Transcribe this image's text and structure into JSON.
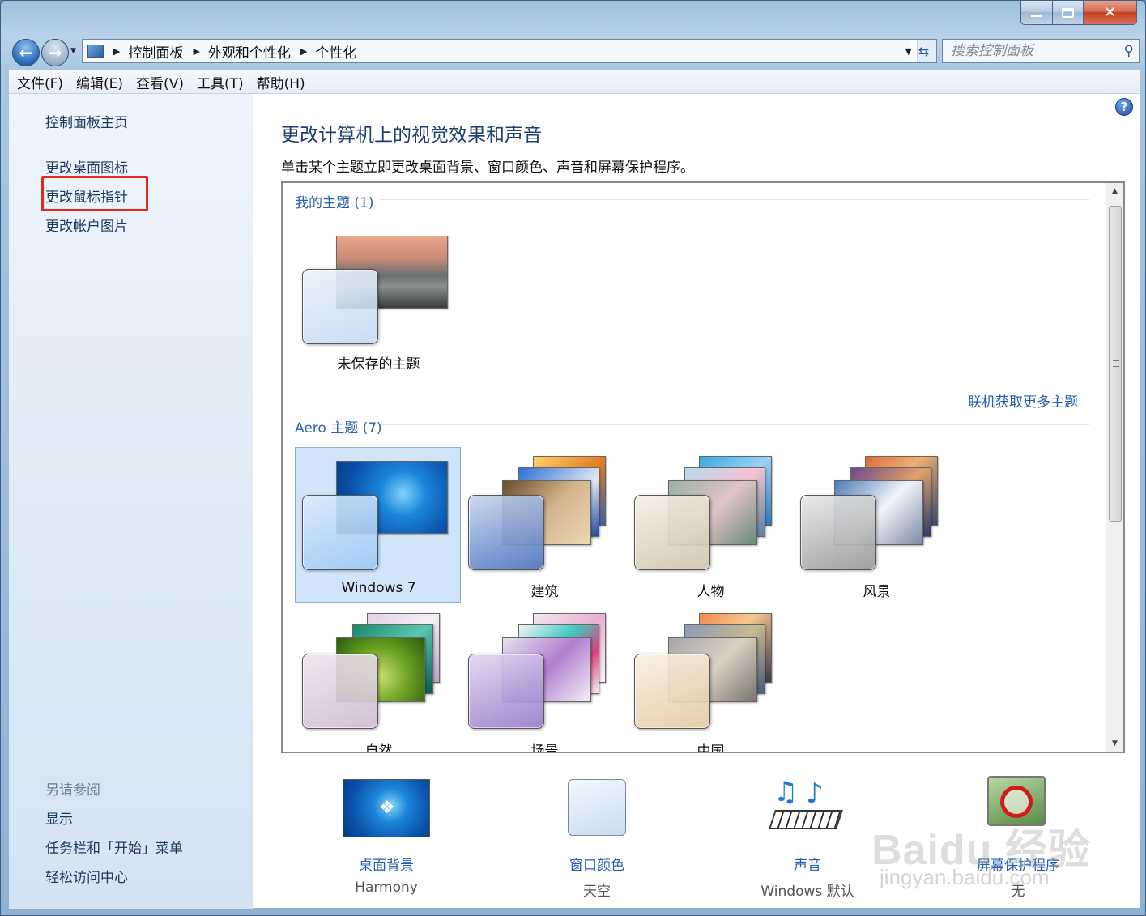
{
  "window": {
    "title": "",
    "min_icon": "minimize-icon",
    "max_icon": "maximize-icon",
    "close_icon": "close-icon"
  },
  "nav": {
    "address_path": [
      "控制面板",
      "外观和个性化",
      "个性化"
    ],
    "search_placeholder": "搜索控制面板"
  },
  "menu": [
    "文件(F)",
    "编辑(E)",
    "查看(V)",
    "工具(T)",
    "帮助(H)"
  ],
  "sidebar": {
    "home": "控制面板主页",
    "links": [
      "更改桌面图标",
      "更改鼠标指针",
      "更改帐户图片"
    ],
    "see_also_title": "另请参阅",
    "see_also": [
      "显示",
      "任务栏和「开始」菜单",
      "轻松访问中心"
    ]
  },
  "main": {
    "title": "更改计算机上的视觉效果和声音",
    "description": "单击某个主题立即更改桌面背景、窗口颜色、声音和屏幕保护程序。",
    "my_themes_header": "我的主题 (1)",
    "get_more_link": "联机获取更多主题",
    "aero_header": "Aero 主题 (7)",
    "my_themes": [
      "未保存的主题"
    ],
    "aero_themes": [
      "Windows 7",
      "建筑",
      "人物",
      "风景",
      "自然",
      "场景",
      "中国"
    ],
    "selected_theme": "Windows 7"
  },
  "settings": [
    {
      "label": "桌面背景",
      "value": "Harmony"
    },
    {
      "label": "窗口颜色",
      "value": "天空"
    },
    {
      "label": "声音",
      "value": "Windows 默认"
    },
    {
      "label": "屏幕保护程序",
      "value": "无"
    }
  ],
  "watermark": {
    "brand": "Baidu 经验",
    "url": "jingyan.baidu.com"
  },
  "colors": {
    "highlight_box": "#e0281e",
    "link_blue": "#1f5fae",
    "title_blue": "#1e3f72"
  }
}
